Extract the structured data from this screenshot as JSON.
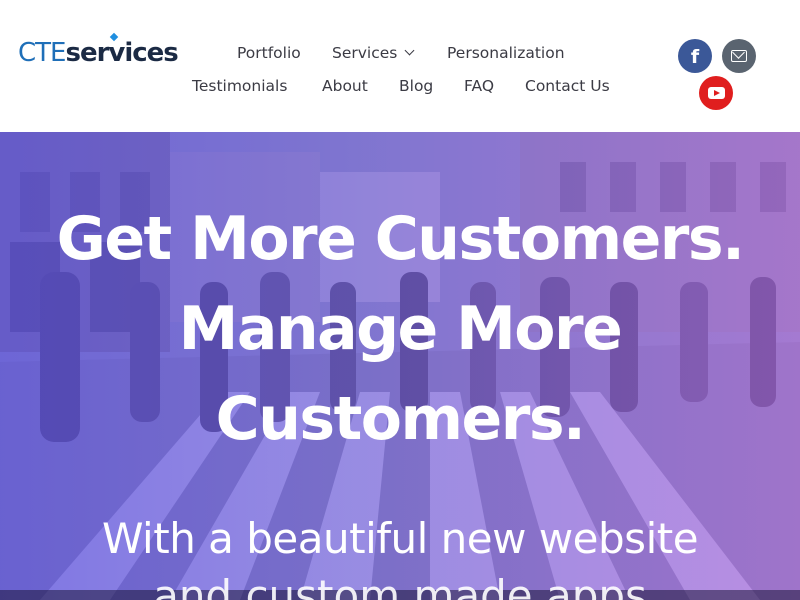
{
  "brand": {
    "logo_part1": "CTE",
    "logo_part2": "services"
  },
  "nav": {
    "row1": [
      {
        "label": "Portfolio"
      },
      {
        "label": "Services",
        "has_dropdown": true
      },
      {
        "label": "Personalization"
      }
    ],
    "row2": [
      {
        "label": "Testimonials"
      },
      {
        "label": "About"
      },
      {
        "label": "Blog"
      },
      {
        "label": "FAQ"
      },
      {
        "label": "Contact Us"
      }
    ]
  },
  "social": {
    "facebook": {
      "icon": "facebook-icon",
      "glyph": "f",
      "color": "#3b5898"
    },
    "email": {
      "icon": "mail-icon",
      "color": "#5a6470"
    },
    "youtube": {
      "icon": "youtube-icon",
      "color": "#e01e1e"
    }
  },
  "hero": {
    "headline_lines": [
      "Get More Customers.",
      "Manage More",
      "Customers."
    ],
    "subheadline": "With a beautiful new website",
    "subheadline_cont": "and custom made apps",
    "overlay_colors": [
      "#6256e8",
      "#b26ee8"
    ]
  }
}
